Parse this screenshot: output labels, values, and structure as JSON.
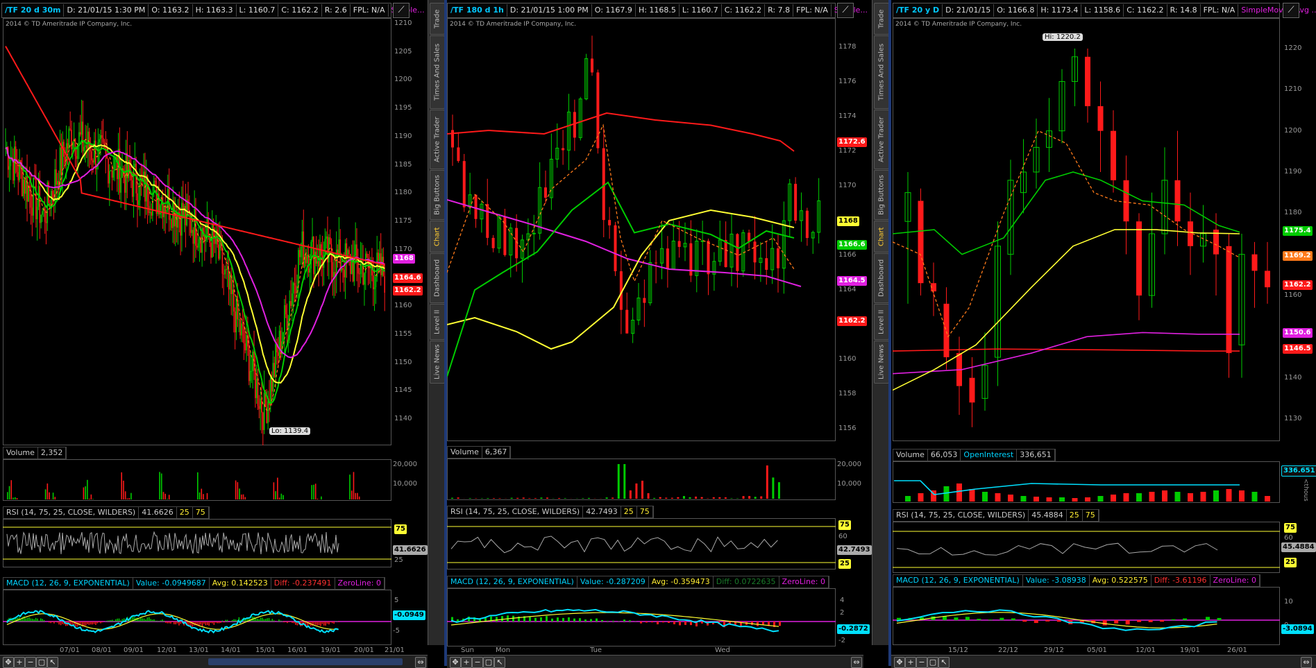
{
  "colors": {
    "bg": "#000000",
    "green": "#00cc00",
    "red": "#ff1a1a",
    "yellow": "#ffff33",
    "magenta": "#e020e0",
    "cyan": "#00e0ff",
    "sep": "#1f3a78"
  },
  "sidetabs": [
    "Trade",
    "Times And Sales",
    "Active Trader",
    "Big Buttons",
    "Chart",
    "Dashboard",
    "Level II",
    "Live News"
  ],
  "sidetab_active": "Chart",
  "panels": [
    {
      "header": {
        "symbol": "/TF 20 d 30m",
        "date": "D: 21/01/15 1:30 PM",
        "open": "O: 1163.2",
        "high": "H: 1163.3",
        "low": "L: 1160.7",
        "close": "C: 1162.2",
        "range": "R: 2.6",
        "fpl": "FPL: N/A",
        "study": "Simple..."
      },
      "copyright": "2014 © TD Ameritrade IP Company, Inc.",
      "yticks": [
        "1210",
        "1205",
        "1200",
        "1195",
        "1190",
        "1185",
        "1180",
        "1175",
        "1170",
        "1165",
        "1160",
        "1155",
        "1150",
        "1145",
        "1140"
      ],
      "price_tags": [
        {
          "text": "1168",
          "color": "#e020e0"
        },
        {
          "text": "1164.6",
          "color": "#ff1a1a"
        },
        {
          "text": "1162.2",
          "color": "#ff1a1a"
        }
      ],
      "lo_label": "Lo: 1139.4",
      "volume": {
        "label": "Volume",
        "value": "2,352",
        "ticks": [
          "20,000",
          "10,000"
        ]
      },
      "rsi": {
        "label": "RSI (14, 75, 25, CLOSE, WILDERS)",
        "value": "41.6626",
        "ob": "25",
        "os": "75",
        "tag": "41.6626",
        "levels": [
          "75",
          "25"
        ]
      },
      "macd": {
        "label": "MACD (12, 26, 9, EXPONENTIAL)",
        "value": "Value: -0.0949687",
        "avg": "Avg: 0.142523",
        "diff": "Diff: -0.237491",
        "zero": "ZeroLine: 0",
        "tag": "-0.0949",
        "ticks": [
          "5",
          "0",
          "-5"
        ]
      },
      "xticks": [
        "07/01",
        "08/01",
        "09/01",
        "12/01",
        "13/01",
        "14/01",
        "15/01",
        "16/01",
        "19/01",
        "20/01",
        "21/01"
      ]
    },
    {
      "header": {
        "symbol": "/TF 180 d 1h",
        "date": "D: 21/01/15 1:00 PM",
        "open": "O: 1167.9",
        "high": "H: 1168.5",
        "low": "L: 1160.7",
        "close": "C: 1162.2",
        "range": "R: 7.8",
        "fpl": "FPL: N/A",
        "study": "Simple..."
      },
      "copyright": "2014 © TD Ameritrade IP Company, Inc.",
      "yticks": [
        "1178",
        "1176",
        "1174",
        "1172",
        "1170",
        "1168",
        "1166",
        "1164",
        "1162",
        "1160",
        "1158",
        "1156"
      ],
      "price_tags": [
        {
          "text": "1172.6",
          "color": "#ff1a1a"
        },
        {
          "text": "1168",
          "color": "#ffff33"
        },
        {
          "text": "1166.6",
          "color": "#00cc00"
        },
        {
          "text": "1164.5",
          "color": "#e020e0"
        },
        {
          "text": "1162.2",
          "color": "#ff1a1a"
        }
      ],
      "volume": {
        "label": "Volume",
        "value": "6,367",
        "ticks": [
          "20,000",
          "10,000"
        ]
      },
      "rsi": {
        "label": "RSI (14, 75, 25, CLOSE, WILDERS)",
        "value": "42.7493",
        "ob": "25",
        "os": "75",
        "tag": "42.7493",
        "levels": [
          "75",
          "60",
          "40",
          "25"
        ]
      },
      "macd": {
        "label": "MACD (12, 26, 9, EXPONENTIAL)",
        "value": "Value: -0.287209",
        "avg": "Avg: -0.359473",
        "diff": "Diff: 0.0722635",
        "zero": "ZeroLine: 0",
        "tag": "-0.2872",
        "ticks": [
          "4",
          "2",
          "0",
          "-2"
        ]
      },
      "xticks": [
        "Sun",
        "Mon",
        "Tue",
        "Wed"
      ]
    },
    {
      "header": {
        "symbol": "/TF 20 y D",
        "date": "D: 21/01/15",
        "open": "O: 1166.8",
        "high": "H: 1173.4",
        "low": "L: 1158.6",
        "close": "C: 1162.2",
        "range": "R: 14.8",
        "fpl": "FPL: N/A",
        "study": "SimpleMovingAvg ..."
      },
      "copyright": "2014 © TD Ameritrade IP Company, Inc.",
      "yticks": [
        "1220",
        "1210",
        "1200",
        "1190",
        "1180",
        "1170",
        "1160",
        "1150",
        "1140",
        "1130"
      ],
      "price_tags": [
        {
          "text": "1175.4",
          "color": "#00cc00"
        },
        {
          "text": "1169.2",
          "color": "#ff7a1a"
        },
        {
          "text": "1162.2",
          "color": "#ff1a1a"
        },
        {
          "text": "1150.6",
          "color": "#e020e0"
        },
        {
          "text": "1146.5",
          "color": "#ff1a1a"
        }
      ],
      "hi_label": "Hi: 1220.2",
      "volume": {
        "label": "Volume",
        "value": "66,053",
        "oi_label": "OpenInterest",
        "oi_value": "336,651",
        "tag": "336.651",
        "unit": "<thous"
      },
      "rsi": {
        "label": "RSI (14, 75, 25, CLOSE, WILDERS)",
        "value": "45.4884",
        "ob": "25",
        "os": "75",
        "tag": "45.4884",
        "levels": [
          "75",
          "60",
          "40",
          "25"
        ]
      },
      "macd": {
        "label": "MACD (12, 26, 9, EXPONENTIAL)",
        "value": "Value: -3.08938",
        "avg": "Avg: 0.522575",
        "diff": "Diff: -3.61196",
        "zero": "ZeroLine: 0",
        "tag": "-3.0894",
        "ticks": [
          "10",
          "0"
        ]
      },
      "xticks": [
        "15/12",
        "22/12",
        "29/12",
        "05/01",
        "12/01",
        "19/01",
        "26/01"
      ]
    }
  ]
}
